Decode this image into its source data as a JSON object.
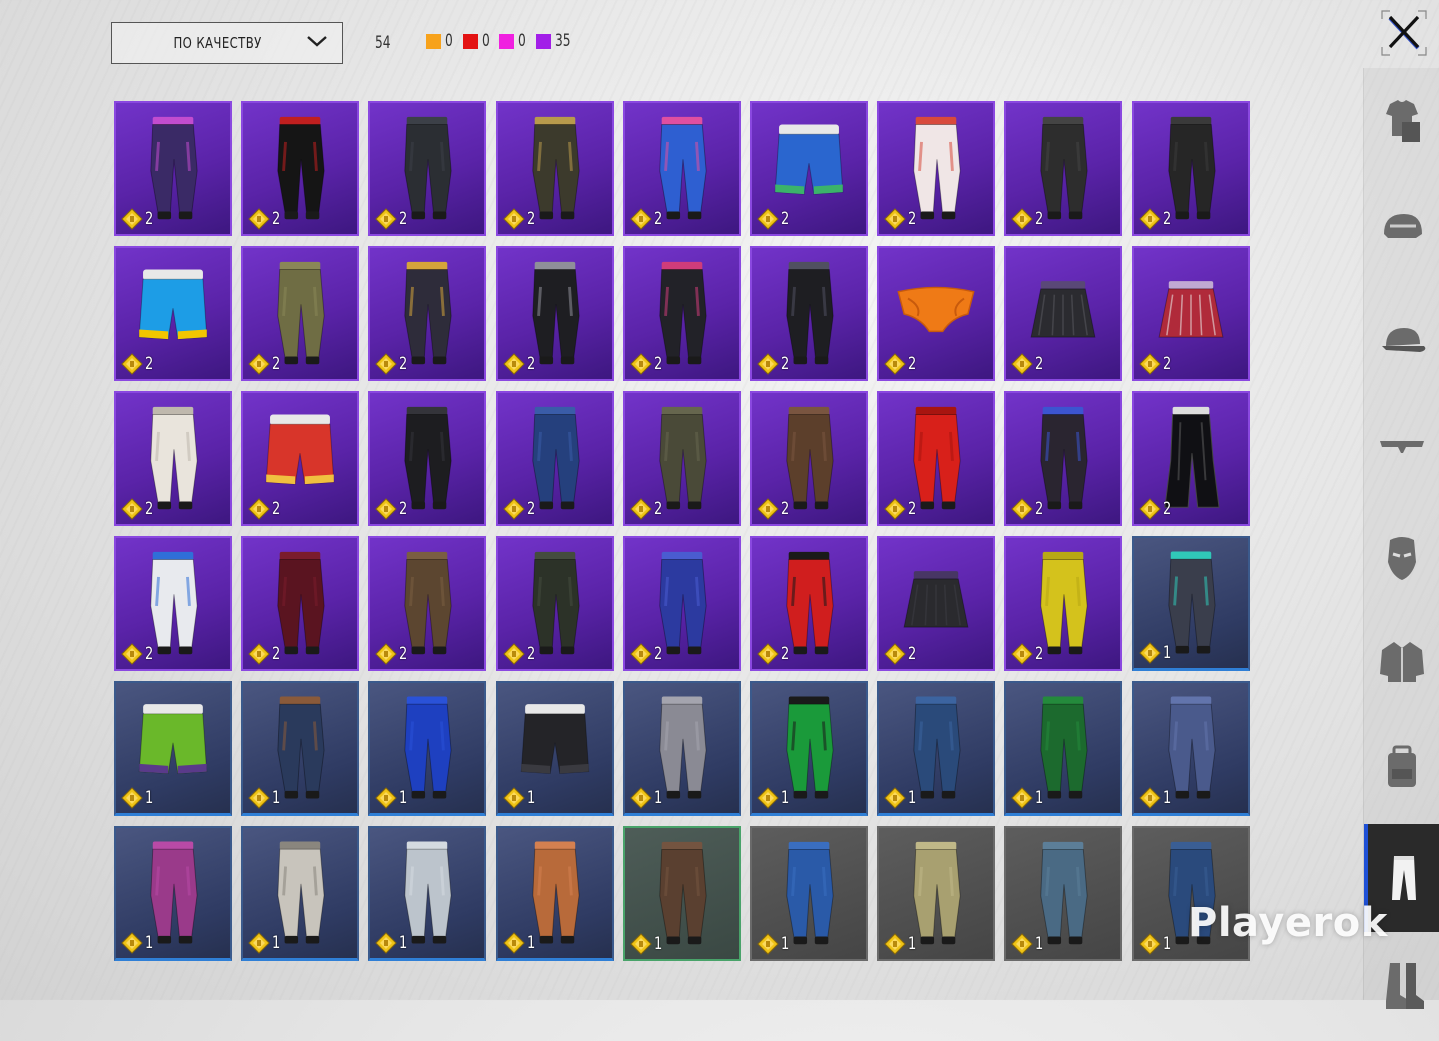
{
  "toolbar": {
    "sort_label": "ПО КАЧЕСТВУ",
    "total_count": "54",
    "legend": [
      {
        "color": "#f7a21b",
        "count": "0"
      },
      {
        "color": "#e31212",
        "count": "0"
      },
      {
        "color": "#f020e0",
        "count": "0"
      },
      {
        "color": "#a21ee8",
        "count": "35"
      }
    ],
    "close_icon": "close-icon"
  },
  "grid": {
    "badge_icon": "diamond-badge-icon",
    "items": [
      {
        "q": "epic",
        "count": "2",
        "p": "#3a2a66",
        "a": "#c24ccf",
        "shape": "pants"
      },
      {
        "q": "epic",
        "count": "2",
        "p": "#151515",
        "a": "#c01f1f",
        "shape": "pants"
      },
      {
        "q": "epic",
        "count": "2",
        "p": "#2b2e33",
        "a": "#3c4048",
        "shape": "pants"
      },
      {
        "q": "epic",
        "count": "2",
        "p": "#3c3a2c",
        "a": "#b89a4c",
        "shape": "pants"
      },
      {
        "q": "epic",
        "count": "2",
        "p": "#2e5fd1",
        "a": "#e04fa0",
        "shape": "pants"
      },
      {
        "q": "epic",
        "count": "2",
        "p": "#2a66cf",
        "a": "#3bb36a",
        "shape": "shorts"
      },
      {
        "q": "epic",
        "count": "2",
        "p": "#f0e6e6",
        "a": "#d84a3c",
        "shape": "pants"
      },
      {
        "q": "epic",
        "count": "2",
        "p": "#2d2d2d",
        "a": "#444",
        "shape": "pants"
      },
      {
        "q": "epic",
        "count": "2",
        "p": "#262626",
        "a": "#3a3a3a",
        "shape": "pants"
      },
      {
        "q": "epic",
        "count": "2",
        "p": "#1d9de6",
        "a": "#f2c600",
        "shape": "shorts"
      },
      {
        "q": "epic",
        "count": "2",
        "p": "#6f6d44",
        "a": "#8a8757",
        "shape": "pants"
      },
      {
        "q": "epic",
        "count": "2",
        "p": "#2e2c3a",
        "a": "#d5a43a",
        "shape": "pants"
      },
      {
        "q": "epic",
        "count": "2",
        "p": "#1e1e22",
        "a": "#8f8f99",
        "shape": "pants"
      },
      {
        "q": "epic",
        "count": "2",
        "p": "#222228",
        "a": "#d03c7a",
        "shape": "pants"
      },
      {
        "q": "epic",
        "count": "2",
        "p": "#1e1e22",
        "a": "#505060",
        "shape": "pants"
      },
      {
        "q": "epic",
        "count": "2",
        "p": "#ef7a16",
        "a": "#c85a0c",
        "shape": "briefs"
      },
      {
        "q": "epic",
        "count": "2",
        "p": "#2b2b30",
        "a": "#55555c",
        "shape": "skirt"
      },
      {
        "q": "epic",
        "count": "2",
        "p": "#b02a3a",
        "a": "#e8e0e0",
        "shape": "skirt"
      },
      {
        "q": "epic",
        "count": "2",
        "p": "#e9e4dc",
        "a": "#bfb8ad",
        "shape": "pants"
      },
      {
        "q": "epic",
        "count": "2",
        "p": "#d8352a",
        "a": "#f0c040",
        "shape": "shorts"
      },
      {
        "q": "epic",
        "count": "2",
        "p": "#1d1d20",
        "a": "#34343a",
        "shape": "pants"
      },
      {
        "q": "epic",
        "count": "2",
        "p": "#25407d",
        "a": "#3a5ca8",
        "shape": "pants"
      },
      {
        "q": "epic",
        "count": "2",
        "p": "#4a4a38",
        "a": "#66664e",
        "shape": "pants"
      },
      {
        "q": "epic",
        "count": "2",
        "p": "#5c3f2b",
        "a": "#7a5540",
        "shape": "pants"
      },
      {
        "q": "epic",
        "count": "2",
        "p": "#d8201a",
        "a": "#a81510",
        "shape": "pants"
      },
      {
        "q": "epic",
        "count": "2",
        "p": "#2a2530",
        "a": "#3c55d0",
        "shape": "pants"
      },
      {
        "q": "epic",
        "count": "2",
        "p": "#101014",
        "a": "#2a2a30",
        "shape": "flare"
      },
      {
        "q": "epic",
        "count": "2",
        "p": "#e8eaee",
        "a": "#2f6fd8",
        "shape": "pants"
      },
      {
        "q": "epic",
        "count": "2",
        "p": "#5a1420",
        "a": "#7a1c2c",
        "shape": "pants"
      },
      {
        "q": "epic",
        "count": "2",
        "p": "#5c4630",
        "a": "#7a5e42",
        "shape": "pants"
      },
      {
        "q": "epic",
        "count": "2",
        "p": "#2c3228",
        "a": "#444c3e",
        "shape": "pants"
      },
      {
        "q": "epic",
        "count": "2",
        "p": "#2c3aa0",
        "a": "#4a5cd0",
        "shape": "pants"
      },
      {
        "q": "epic",
        "count": "2",
        "p": "#d01e1e",
        "a": "#1a1a1a",
        "shape": "pants"
      },
      {
        "q": "epic",
        "count": "2",
        "p": "#2a2a2e",
        "a": "#3c3c42",
        "shape": "skirt"
      },
      {
        "q": "epic",
        "count": "2",
        "p": "#d4c21c",
        "a": "#b8a814",
        "shape": "pants"
      },
      {
        "q": "rare",
        "count": "1",
        "p": "#3a3e4c",
        "a": "#30c8b8",
        "shape": "pants"
      },
      {
        "q": "rare",
        "count": "1",
        "p": "#6ab82a",
        "a": "#5a3a8a",
        "shape": "shorts"
      },
      {
        "q": "rare",
        "count": "1",
        "p": "#2a3a5c",
        "a": "#8a5a3a",
        "shape": "pants"
      },
      {
        "q": "rare",
        "count": "1",
        "p": "#1e40c0",
        "a": "#2a52d8",
        "shape": "pants"
      },
      {
        "q": "rare",
        "count": "1",
        "p": "#242428",
        "a": "#3a3a40",
        "shape": "shorts"
      },
      {
        "q": "rare",
        "count": "1",
        "p": "#8a8a94",
        "a": "#a4a4ae",
        "shape": "pants"
      },
      {
        "q": "rare",
        "count": "1",
        "p": "#1a9a3a",
        "a": "#1a1a1a",
        "shape": "pants"
      },
      {
        "q": "rare",
        "count": "1",
        "p": "#2a4a7a",
        "a": "#3c64a0",
        "shape": "pants"
      },
      {
        "q": "rare",
        "count": "1",
        "p": "#1c6a2e",
        "a": "#248a3c",
        "shape": "pants"
      },
      {
        "q": "rare",
        "count": "1",
        "p": "#4a5a8c",
        "a": "#6274ac",
        "shape": "pants"
      },
      {
        "q": "rare",
        "count": "1",
        "p": "#9a3a8a",
        "a": "#b84aa6",
        "shape": "pants"
      },
      {
        "q": "rare",
        "count": "1",
        "p": "#c8c4bc",
        "a": "#8a867e",
        "shape": "pants"
      },
      {
        "q": "rare",
        "count": "1",
        "p": "#bcc4cc",
        "a": "#d4dae0",
        "shape": "pants"
      },
      {
        "q": "rare",
        "count": "1",
        "p": "#b86a3a",
        "a": "#d48050",
        "shape": "pants"
      },
      {
        "q": "uncommon",
        "count": "1",
        "p": "#5a4030",
        "a": "#745440",
        "shape": "pants"
      },
      {
        "q": "common",
        "count": "1",
        "p": "#2a5aa8",
        "a": "#3a6ec0",
        "shape": "pants"
      },
      {
        "q": "common",
        "count": "1",
        "p": "#a8a070",
        "a": "#c0b888",
        "shape": "pants"
      },
      {
        "q": "common",
        "count": "1",
        "p": "#4a6a84",
        "a": "#5c7e98",
        "shape": "pants"
      },
      {
        "q": "common",
        "count": "1",
        "p": "#2a4a7c",
        "a": "#3a5e94",
        "shape": "pants"
      }
    ]
  },
  "side_tabs": [
    {
      "icon": "outfit-icon",
      "active": false
    },
    {
      "icon": "helmet-icon",
      "active": false
    },
    {
      "icon": "cap-icon",
      "active": false
    },
    {
      "icon": "glasses-icon",
      "active": false
    },
    {
      "icon": "mask-icon",
      "active": false
    },
    {
      "icon": "jacket-icon",
      "active": false
    },
    {
      "icon": "backpack-icon",
      "active": false
    },
    {
      "icon": "pants-icon",
      "active": true
    },
    {
      "icon": "boots-icon",
      "active": false
    }
  ],
  "watermark": "Playerok"
}
